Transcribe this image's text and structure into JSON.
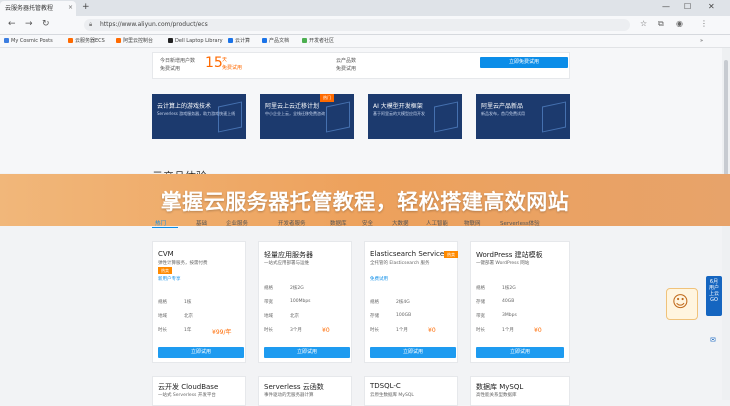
{
  "browser": {
    "tab_title": "云服务器托管教程",
    "tab_close": "×",
    "new_tab": "+",
    "minimize": "—",
    "maximize": "☐",
    "close": "✕",
    "back": "←",
    "forward": "→",
    "reload": "↻",
    "address": "https://www.aliyun.com/product/ecs",
    "bookmarks": [
      {
        "label": "My Cosmic Posts",
        "color": "#3b7de0"
      },
      {
        "label": "云服务器ECS",
        "color": "#ff6a00"
      },
      {
        "label": "阿里云控制台",
        "color": "#ff6a00"
      },
      {
        "label": "Dell Laptop Library",
        "color": "#222"
      },
      {
        "label": "云计算",
        "color": "#1a73e8"
      },
      {
        "label": "产品文档",
        "color": "#1a73e8"
      },
      {
        "label": "开发者社区",
        "color": "#4caf50"
      }
    ]
  },
  "hero": {
    "stat1_label": "今日新增用户数",
    "stat1_sub": "免费试用",
    "stat_number": "15",
    "stat_unit": "天",
    "stat_unit2": "免费试用",
    "stat2_label": "云产品数",
    "stat2_sub": "免费试用",
    "cta_label": "立即免费试用"
  },
  "promos": [
    {
      "title": "云计算上的游戏技术",
      "desc": "Serverless 游戏服务器，助力游戏快速上线",
      "tag": ""
    },
    {
      "title": "阿里云上云迁移计划",
      "desc": "中小企业上云，全栈迁移免费咨询",
      "tag": "热门"
    },
    {
      "title": "AI 大模型开发框架",
      "desc": "基于阿里云的大模型应用开发",
      "tag": ""
    },
    {
      "title": "阿里云产品新品",
      "desc": "新品发布，首月免费试用",
      "tag": ""
    }
  ],
  "banner": {
    "headline": "掌握云服务器托管教程，轻松搭建高效网站"
  },
  "section": {
    "title": "云产品体验",
    "tabs": [
      "热门",
      "基础",
      "企业服务",
      "开发者服务",
      "数据库",
      "安全",
      "大数据",
      "人工智能",
      "物联网",
      "Serverless体验"
    ]
  },
  "products": [
    {
      "name": "CVM",
      "badge": "热卖",
      "lines": [
        "弹性计算服务，按需付费",
        "新用户专享",
        "规格",
        "地域",
        "时长"
      ],
      "values": [
        "",
        "",
        "1核",
        "北京",
        "1年"
      ],
      "price": "¥99/年",
      "button": "立即试用"
    },
    {
      "name": "轻量应用服务器",
      "badge": "",
      "lines": [
        "一站式应用部署与运维",
        "规格",
        "带宽",
        "地域",
        "时长"
      ],
      "values": [
        "",
        "2核2G",
        "100Mbps",
        "北京",
        "3个月"
      ],
      "price": "¥0",
      "button": "立即试用"
    },
    {
      "name": "Elasticsearch Service",
      "badge": "热卖",
      "lines": [
        "全托管的 Elasticsearch 服务",
        "免费试用",
        "规格",
        "存储",
        "时长"
      ],
      "values": [
        "",
        "",
        "2核4G",
        "100GB",
        "1个月"
      ],
      "price": "¥0",
      "button": "立即试用"
    },
    {
      "name": "WordPress 建站模板",
      "badge": "",
      "lines": [
        "一键部署 WordPress 网站",
        "规格",
        "存储",
        "带宽",
        "时长"
      ],
      "values": [
        "",
        "1核2G",
        "40GB",
        "3Mbps",
        "1个月"
      ],
      "price": "¥0",
      "button": "立即试用"
    }
  ],
  "products_row2": [
    {
      "name": "云开发 CloudBase",
      "line": "一站式 Serverless 开发平台"
    },
    {
      "name": "Serverless 云函数",
      "line": "事件驱动的无服务器计算"
    },
    {
      "name": "TDSQL-C",
      "line": "云原生数据库 MySQL"
    },
    {
      "name": "数据库 MySQL",
      "line": "高性能关系型数据库"
    }
  ],
  "float": {
    "tab_text": "6月 用户 上云 GO",
    "icon": "✉"
  },
  "colors": {
    "accent": "#ff6a00",
    "primary_blue": "#0b8de8",
    "banner_orange": "#eda15c",
    "promo_navy": "#1c3a6e"
  }
}
